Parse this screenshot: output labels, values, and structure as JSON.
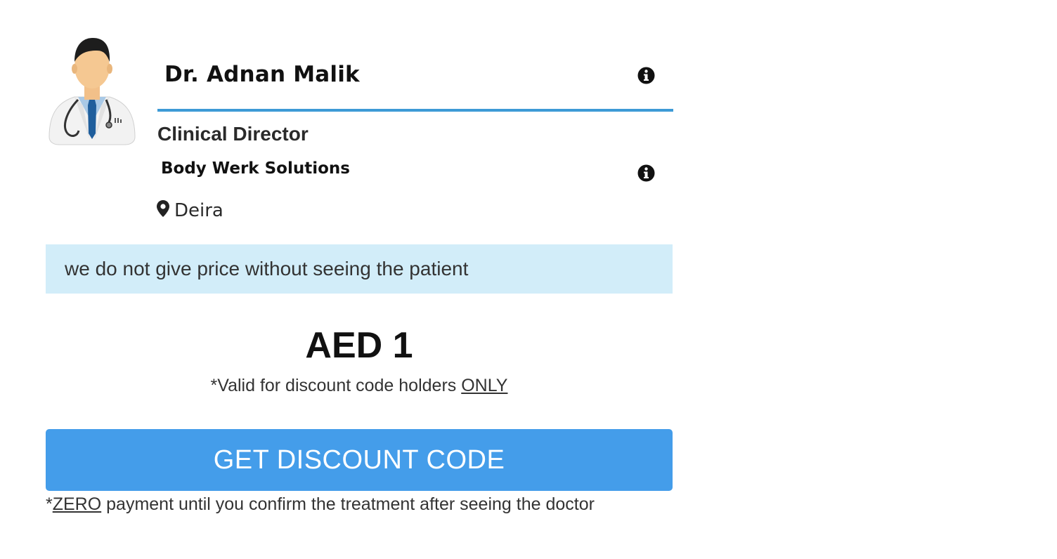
{
  "doctor": {
    "name": "Dr. Adnan Malik",
    "title": "Clinical Director",
    "clinic": "Body Werk Solutions",
    "location": "Deira",
    "avatar_icon": "doctor-avatar-icon"
  },
  "notice": {
    "text": "we do not give price without seeing the patient"
  },
  "pricing": {
    "price": "AED 1",
    "validity_prefix": "*Valid for discount code holders ",
    "validity_emphasis": "ONLY"
  },
  "cta": {
    "label": "GET DISCOUNT CODE"
  },
  "footnote": {
    "prefix": "*",
    "emphasis": "ZERO",
    "suffix": " payment until you confirm the treatment after seeing the doctor"
  },
  "colors": {
    "accent": "#3d9ad6",
    "button": "#449dea",
    "notice_bg": "#d2edf9"
  },
  "icons": {
    "info": "info-icon",
    "location": "map-pin-icon"
  }
}
